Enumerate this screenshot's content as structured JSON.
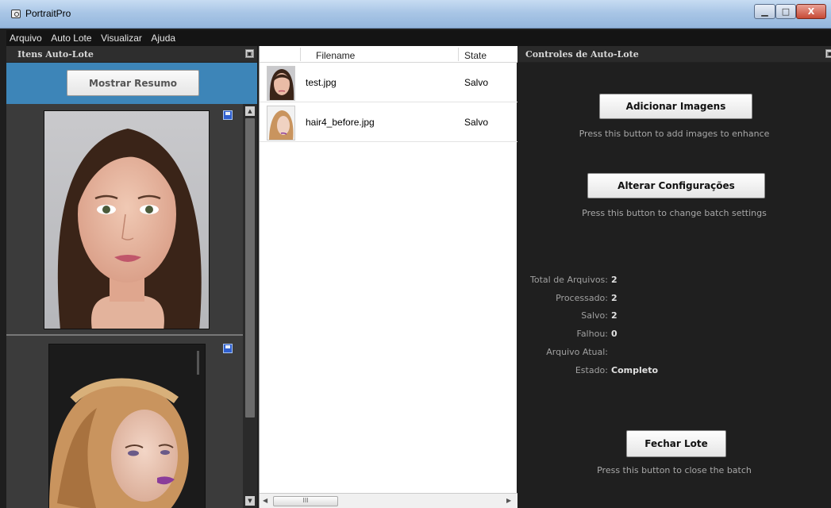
{
  "window": {
    "title": "PortraitPro",
    "minimize_glyph": "▁",
    "maximize_glyph": "□",
    "close_glyph": "X"
  },
  "menu": [
    "Arquivo",
    "Auto Lote",
    "Visualizar",
    "Ajuda"
  ],
  "left_panel": {
    "title": "Itens Auto-Lote",
    "summary_button": "Mostrar Resumo"
  },
  "file_list": {
    "columns": [
      "Filename",
      "State"
    ],
    "rows": [
      {
        "filename": "test.jpg",
        "state": "Salvo"
      },
      {
        "filename": "hair4_before.jpg",
        "state": "Salvo"
      }
    ],
    "hscroll_glyph": "III"
  },
  "right_panel": {
    "title": "Controles de Auto-Lote",
    "add_button": "Adicionar Imagens",
    "add_hint": "Press this button to add images to enhance",
    "settings_button": "Alterar Configurações",
    "settings_hint": "Press this button to change batch settings",
    "stats": [
      {
        "label": "Total de Arquivos:",
        "value": "2"
      },
      {
        "label": "Processado:",
        "value": "2"
      },
      {
        "label": "Salvo:",
        "value": "2"
      },
      {
        "label": "Falhou:",
        "value": "0"
      },
      {
        "label": "Arquivo Atual:",
        "value": ""
      },
      {
        "label": "Estado:",
        "value": "Completo"
      }
    ],
    "close_button": "Fechar Lote",
    "close_hint": "Press this button to close the batch"
  },
  "colors": {
    "accent_blue": "#3d85b8",
    "panel_dark": "#1f1f1f",
    "save_icon": "#2f5fcf"
  },
  "icons": [
    "app-icon",
    "pin-icon",
    "save-icon",
    "scroll-arrow-icon"
  ]
}
